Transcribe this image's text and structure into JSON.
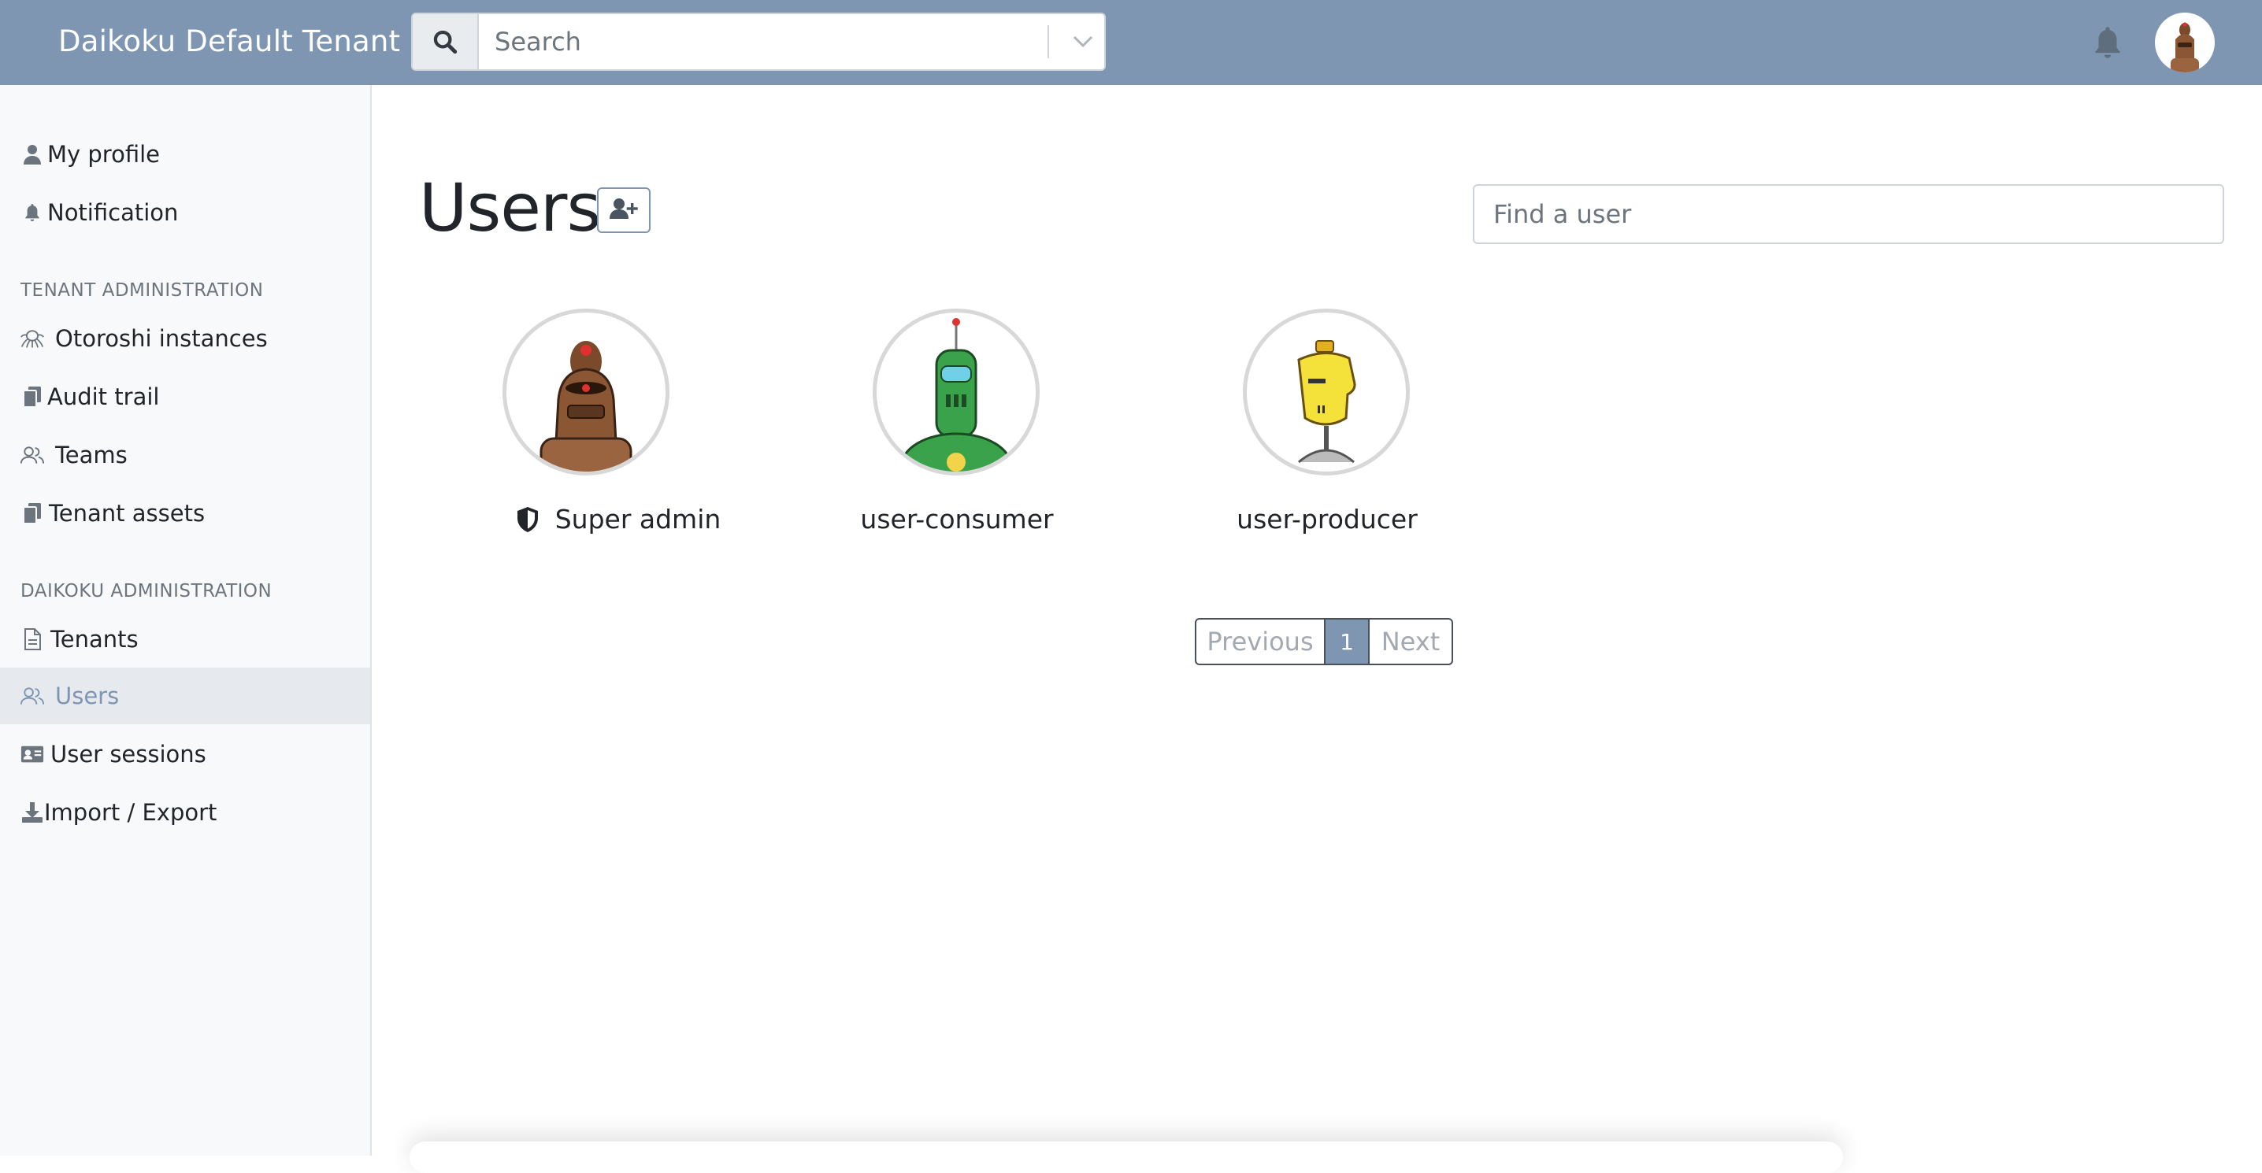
{
  "navbar": {
    "brand": "Daikoku Default Tenant",
    "search_placeholder": "Search",
    "icons": {
      "search": "search-icon",
      "dropdown": "chevron-down-icon",
      "notifications": "bell-icon",
      "avatar": "robot-avatar"
    }
  },
  "sidebar": {
    "items_top": [
      {
        "label": "My profile",
        "icon": "user-icon"
      },
      {
        "label": "Notification",
        "icon": "bell-icon"
      }
    ],
    "tenant_section_title": "TENANT ADMINISTRATION",
    "tenant_items": [
      {
        "label": "Otoroshi instances",
        "icon": "octopus-icon"
      },
      {
        "label": "Audit trail",
        "icon": "copy-icon"
      },
      {
        "label": "Teams",
        "icon": "users-icon"
      },
      {
        "label": "Tenant assets",
        "icon": "copy-icon"
      }
    ],
    "daikoku_section_title": "DAIKOKU ADMINISTRATION",
    "daikoku_items": [
      {
        "label": "Tenants",
        "icon": "file-icon"
      },
      {
        "label": "Users",
        "icon": "users-icon",
        "active": true
      },
      {
        "label": "User sessions",
        "icon": "id-card-icon"
      },
      {
        "label": "Import / Export",
        "icon": "download-icon"
      }
    ]
  },
  "main": {
    "title": "Users",
    "add_user_icon": "user-plus-icon",
    "find_placeholder": "Find a user",
    "users": [
      {
        "name": "Super admin",
        "badge_icon": "shield-icon",
        "avatar": "brown-robot"
      },
      {
        "name": "user-consumer",
        "avatar": "green-robot"
      },
      {
        "name": "user-producer",
        "avatar": "yellow-robot"
      }
    ],
    "pagination": {
      "previous": "Previous",
      "current": "1",
      "next": "Next"
    }
  },
  "colors": {
    "navbar": "#7f96b2",
    "active_text": "#7f96b2",
    "sidebar_bg": "#f8f9fa"
  }
}
